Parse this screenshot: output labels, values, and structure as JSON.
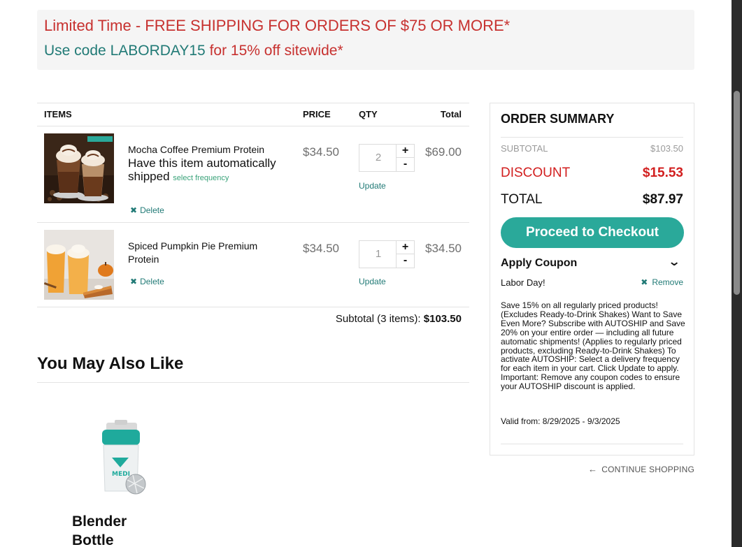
{
  "promo": {
    "line1": "Limited Time - FREE SHIPPING FOR ORDERS OF $75 OR MORE*",
    "line2_prefix": "Use code ",
    "line2_code": "LABORDAY15",
    "line2_mid": " for ",
    "line2_offer": "15% off sitewide*"
  },
  "cart": {
    "headers": {
      "items": "ITEMS",
      "price": "PRICE",
      "qty": "QTY",
      "total": "Total"
    },
    "items": [
      {
        "name": "Mocha Coffee Premium Protein",
        "autoship": "Have this item automatically shipped",
        "select_frequency": "select frequency",
        "delete": "Delete",
        "price": "$34.50",
        "qty": "2",
        "update": "Update",
        "total": "$69.00"
      },
      {
        "name": "Spiced Pumpkin Pie Premium Protein",
        "delete": "Delete",
        "price": "$34.50",
        "qty": "1",
        "update": "Update",
        "total": "$34.50"
      }
    ],
    "qty_plus": "+",
    "qty_minus": "-",
    "subtotal_label": "Subtotal (3 items):",
    "subtotal_value": "$103.50"
  },
  "recommendations": {
    "title": "You May Also Like",
    "items": [
      {
        "name": "Blender Bottle",
        "logo_text": "MEDI"
      }
    ]
  },
  "summary": {
    "title": "ORDER SUMMARY",
    "subtotal_label": "SUBTOTAL",
    "subtotal_value": "$103.50",
    "discount_label": "DISCOUNT",
    "discount_value": "$15.53",
    "total_label": "TOTAL",
    "total_value": "$87.97",
    "checkout_button": "Proceed to Checkout",
    "coupon_heading": "Apply Coupon",
    "coupon_name": "Labor Day!",
    "coupon_remove": "Remove",
    "coupon_description": "Save 15% on all regularly priced products! (Excludes Ready-to-Drink Shakes) Want to Save Even More? Subscribe with AUTOSHIP and Save 20% on your entire order — including all future automatic shipments! (Applies to regularly priced products, excluding Ready-to-Drink Shakes) To activate AUTOSHIP: Select a delivery frequency for each item in your cart. Click Update to apply. Important: Remove any coupon codes to ensure your AUTOSHIP discount is applied.",
    "coupon_valid": "Valid from: 8/29/2025 - 9/3/2025"
  },
  "continue_shopping": "CONTINUE SHOPPING",
  "colors": {
    "promo_red": "#c7312f",
    "promo_teal": "#217a76",
    "checkout_button": "#2aa99a",
    "discount_red": "#d21f1f",
    "link_teal": "#217a76"
  },
  "icons": {
    "delete": "close-x-icon",
    "coupon_toggle": "chevron-down-icon",
    "continue": "arrow-left-icon"
  }
}
